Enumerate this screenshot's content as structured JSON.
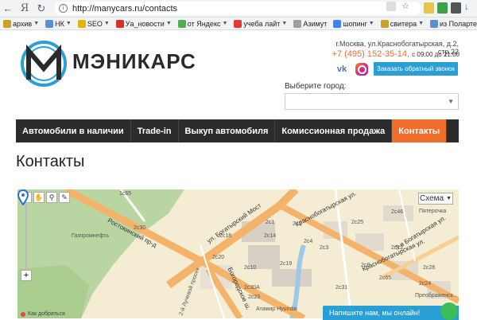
{
  "browser": {
    "url": "http://manycars.ru/contacts",
    "yandex_glyph": "Я",
    "bookmarks": [
      {
        "label": "архив",
        "caret": true
      },
      {
        "label": "НК",
        "caret": true
      },
      {
        "label": "SEO",
        "caret": true
      },
      {
        "label": "Уа_новости",
        "caret": true
      },
      {
        "label": "от Яндекс",
        "caret": true
      },
      {
        "label": "учеба лайт",
        "caret": true
      },
      {
        "label": "Азимут",
        "caret": false
      },
      {
        "label": "шопинг",
        "caret": true
      },
      {
        "label": "свитера",
        "caret": true
      },
      {
        "label": "из Полартек",
        "caret": true
      }
    ]
  },
  "header": {
    "brand": "МЭНИКАРС",
    "address": "г.Москва, ул.Краснобогатырская, д.2, стр.22",
    "phone": "+7 (495) 152-35-14,",
    "hours": "с 09:00 до 21:00",
    "vk": "vk",
    "callback_label": "Заказать обратный звонок",
    "city_label": "Выберите город:",
    "city_value": ""
  },
  "nav": [
    {
      "label": "Автомобили в наличии",
      "active": false
    },
    {
      "label": "Trade-in",
      "active": false
    },
    {
      "label": "Выкуп автомобиля",
      "active": false
    },
    {
      "label": "Комиссионная продажа",
      "active": false
    },
    {
      "label": "Контакты",
      "active": true
    }
  ],
  "page_title": "Контакты",
  "map": {
    "schema_label": "Схема",
    "streets": {
      "rostokinsky": "Ростокинский пр-д",
      "bogatyrsky_most": "ул. Богатырский Мост",
      "krasnobogatyrskaya": "Краснобогатырская ул.",
      "krasnobogatyrskaya2": "Краснобогатырская ул.",
      "bogorodskoe": "Богородское ш.",
      "bogatyrskaya3": "3-я Богатырская ул."
    },
    "labels": [
      "1с65",
      "2с30",
      "2с14",
      "2с4",
      "2с3",
      "2с7",
      "2с18",
      "2с1",
      "2с10",
      "2с19",
      "2с25",
      "2с46",
      "2с30А",
      "2с23",
      "2с31",
      "2с8",
      "2с65",
      "2с12",
      "2с28",
      "2с24",
      "2с20"
    ],
    "poi": {
      "gazprom": "Газпромнефть",
      "atamir": "Атамир Hyundai",
      "luchevoy": "2-й Лучевой просек",
      "preobr": "Преображенск...",
      "pyaterochka": "Пятерочка"
    },
    "where_link": "Как добраться",
    "chat_label": "Напишите нам, мы онлайн!"
  },
  "colors": {
    "accent": "#f06d2b",
    "nav_bg": "#2c2c2c",
    "button_blue": "#2a9fd6"
  }
}
